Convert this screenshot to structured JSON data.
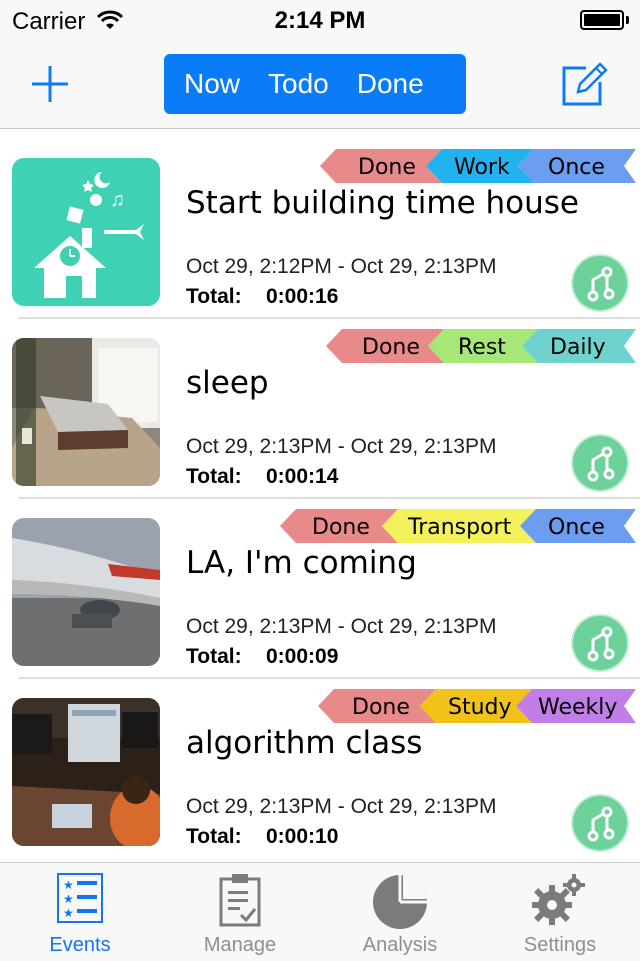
{
  "status_bar": {
    "carrier": "Carrier",
    "time": "2:14 PM"
  },
  "nav": {
    "segments": [
      "Now",
      "Todo",
      "Done"
    ],
    "accent": "#0a7cf7"
  },
  "events": [
    {
      "title": "Start building time house",
      "time_range": "Oct 29, 2:12PM - Oct 29, 2:13PM",
      "total_label": "Total:",
      "total": "0:00:16",
      "tags": {
        "status": "Done",
        "category": "Work",
        "repeat": "Once"
      },
      "tag_colors": {
        "status": "#e8898a",
        "category": "#21b3f0",
        "repeat": "#6b9ef0"
      },
      "thumb": "house-illustration"
    },
    {
      "title": "sleep",
      "time_range": "Oct 29, 2:13PM - Oct 29, 2:13PM",
      "total_label": "Total:",
      "total": "0:00:14",
      "tags": {
        "status": "Done",
        "category": "Rest",
        "repeat": "Daily"
      },
      "tag_colors": {
        "status": "#e8898a",
        "category": "#a6e777",
        "repeat": "#6fd2cf"
      },
      "thumb": "bedroom-photo"
    },
    {
      "title": "LA, I'm coming",
      "time_range": "Oct 29, 2:13PM - Oct 29, 2:13PM",
      "total_label": "Total:",
      "total": "0:00:09",
      "tags": {
        "status": "Done",
        "category": "Transport",
        "repeat": "Once"
      },
      "tag_colors": {
        "status": "#e8898a",
        "category": "#f4f25c",
        "repeat": "#6b9ef0"
      },
      "thumb": "airplane-photo"
    },
    {
      "title": "algorithm class",
      "time_range": "Oct 29, 2:13PM - Oct 29, 2:13PM",
      "total_label": "Total:",
      "total": "0:00:10",
      "tags": {
        "status": "Done",
        "category": "Study",
        "repeat": "Weekly"
      },
      "tag_colors": {
        "status": "#e8898a",
        "category": "#f0c21a",
        "repeat": "#c17ee8"
      },
      "thumb": "classroom-photo"
    }
  ],
  "tabs": [
    {
      "label": "Events",
      "icon": "list-icon",
      "active": true
    },
    {
      "label": "Manage",
      "icon": "clipboard-icon",
      "active": false
    },
    {
      "label": "Analysis",
      "icon": "pie-chart-icon",
      "active": false
    },
    {
      "label": "Settings",
      "icon": "gear-icon",
      "active": false
    }
  ]
}
